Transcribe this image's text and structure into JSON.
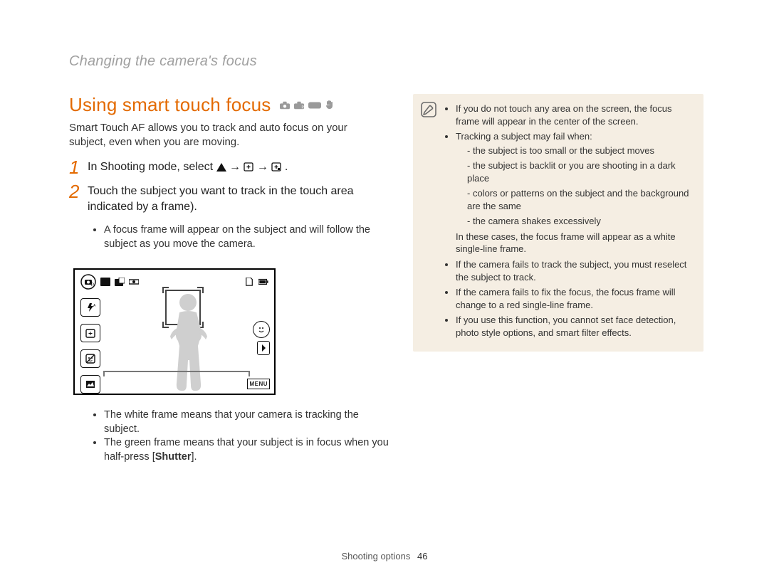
{
  "section_title": "Changing the camera's focus",
  "heading": "Using smart touch focus",
  "intro": "Smart Touch AF allows you to track and auto focus on your subject, even when you are moving.",
  "steps": {
    "s1_num": "1",
    "s1_pre": "In Shooting mode, select",
    "s1_mid1": " → ",
    "s1_mid2": " → ",
    "s1_post": ".",
    "s2_num": "2",
    "s2_txt": "Touch the subject you want to track in the touch area indicated by a frame)."
  },
  "sub1": {
    "b1": "A focus frame will appear on the subject and will follow the subject as you move the camera."
  },
  "sub2": {
    "b1": "The white frame means that your camera is tracking the subject.",
    "b2_pre": "The green frame means that your subject is in focus when you half-press [",
    "b2_strong": "Shutter",
    "b2_post": "]."
  },
  "lcd": {
    "menu_label": "MENU"
  },
  "note": {
    "b1": "If you do not touch any area on the screen, the focus frame will appear in the center of the screen.",
    "b2": "Tracking a subject may fail when:",
    "b2a": "the subject is too small or the subject moves",
    "b2b": "the subject is backlit or you are shooting in a dark place",
    "b2c": "colors or patterns on the subject and the background are the same",
    "b2d": "the camera shakes excessively",
    "b2_tail": "In these cases, the focus frame will appear as a white single-line frame.",
    "b3": "If the camera fails to track the subject, you must reselect the subject to track.",
    "b4": "If the camera fails to fix the focus, the focus frame will change to a red single-line frame.",
    "b5": "If you use this function, you cannot set face detection, photo style options, and smart filter effects."
  },
  "footer": {
    "label": "Shooting options",
    "page": "46"
  }
}
